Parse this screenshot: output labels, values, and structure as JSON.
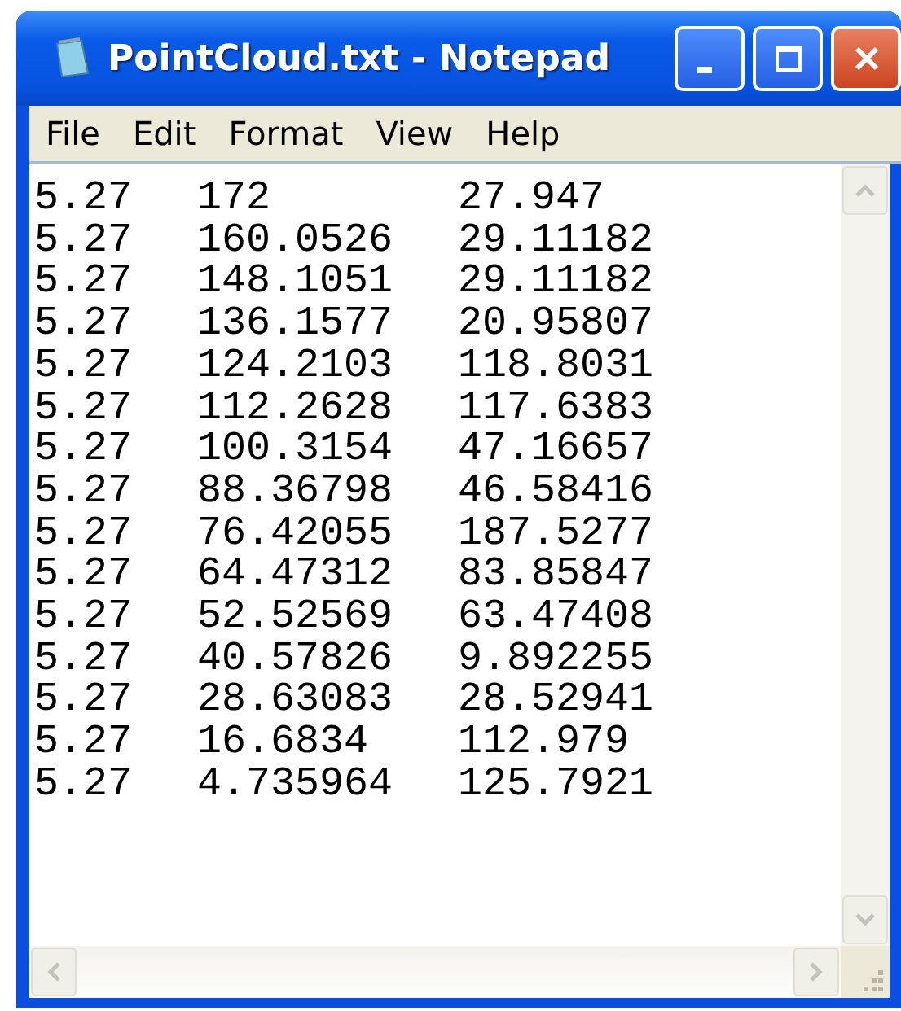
{
  "window": {
    "title": "PointCloud.txt - Notepad"
  },
  "menu": [
    "File",
    "Edit",
    "Format",
    "View",
    "Help"
  ],
  "lines": [
    [
      "5.27",
      "172",
      "27.947"
    ],
    [
      "5.27",
      "160.0526",
      "29.11182"
    ],
    [
      "5.27",
      "148.1051",
      "29.11182"
    ],
    [
      "5.27",
      "136.1577",
      "20.95807"
    ],
    [
      "5.27",
      "124.2103",
      "118.8031"
    ],
    [
      "5.27",
      "112.2628",
      "117.6383"
    ],
    [
      "5.27",
      "100.3154",
      "47.16657"
    ],
    [
      "5.27",
      "88.36798",
      "46.58416"
    ],
    [
      "5.27",
      "76.42055",
      "187.5277"
    ],
    [
      "5.27",
      "64.47312",
      "83.85847"
    ],
    [
      "5.27",
      "52.52569",
      "63.47408"
    ],
    [
      "5.27",
      "40.57826",
      "9.892255"
    ],
    [
      "5.27",
      "28.63083",
      "28.52941"
    ],
    [
      "5.27",
      "16.6834",
      "112.979"
    ],
    [
      "5.27",
      "4.735964",
      "125.7921"
    ]
  ]
}
